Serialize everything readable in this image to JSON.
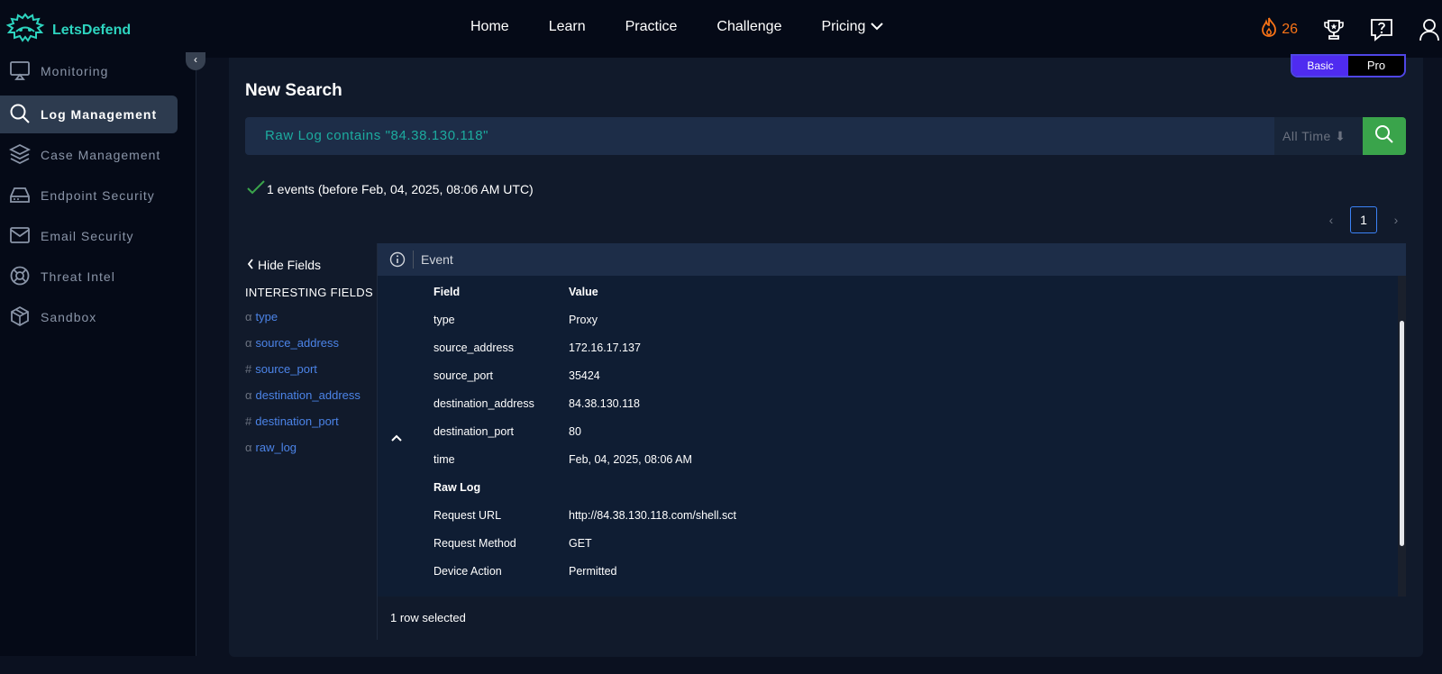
{
  "brand": {
    "name": "LetsDefend",
    "accent": "#2dd4bf"
  },
  "nav": {
    "items": [
      "Home",
      "Learn",
      "Practice",
      "Challenge",
      "Pricing"
    ]
  },
  "topbar": {
    "streak_count": "26"
  },
  "sidebar": {
    "items": [
      {
        "label": "Monitoring",
        "icon": "monitor-icon"
      },
      {
        "label": "Log Management",
        "icon": "search-icon"
      },
      {
        "label": "Case Management",
        "icon": "layers-icon"
      },
      {
        "label": "Endpoint Security",
        "icon": "drive-icon"
      },
      {
        "label": "Email Security",
        "icon": "mail-icon"
      },
      {
        "label": "Threat Intel",
        "icon": "lifebuoy-icon"
      },
      {
        "label": "Sandbox",
        "icon": "cube-icon"
      }
    ],
    "active": "Log Management"
  },
  "plan": {
    "basic": "Basic",
    "pro": "Pro"
  },
  "main": {
    "title": "New Search",
    "query": "Raw Log contains \"84.38.130.118\"",
    "time_range": "All Time ⬇",
    "result_summary": "1 events (before Feb, 04, 2025, 08:06 AM UTC)",
    "page": "1"
  },
  "fields_panel": {
    "hide_label": "Hide Fields",
    "title": "INTERESTING FIELDS",
    "fields": [
      {
        "sym": "α",
        "name": "type"
      },
      {
        "sym": "α",
        "name": "source_address"
      },
      {
        "sym": "#",
        "name": "source_port"
      },
      {
        "sym": "α",
        "name": "destination_address"
      },
      {
        "sym": "#",
        "name": "destination_port"
      },
      {
        "sym": "α",
        "name": "raw_log"
      }
    ]
  },
  "event": {
    "header": "Event",
    "col_field": "Field",
    "col_value": "Value",
    "rows": [
      {
        "k": "type",
        "v": "Proxy"
      },
      {
        "k": "source_address",
        "v": "172.16.17.137"
      },
      {
        "k": "source_port",
        "v": "35424"
      },
      {
        "k": "destination_address",
        "v": "84.38.130.118"
      },
      {
        "k": "destination_port",
        "v": "80"
      },
      {
        "k": "time",
        "v": "Feb, 04, 2025, 08:06 AM"
      }
    ],
    "raw_log_title": "Raw Log",
    "raw_rows": [
      {
        "k": "Request URL",
        "v": "http://84.38.130.118.com/shell.sct"
      },
      {
        "k": "Request Method",
        "v": "GET"
      },
      {
        "k": "Device Action",
        "v": "Permitted"
      }
    ],
    "footer": "1 row selected"
  },
  "colors": {
    "search_button": "#3aa44b",
    "plan_basic": "#4f2bf0",
    "link": "#4c84e8"
  }
}
